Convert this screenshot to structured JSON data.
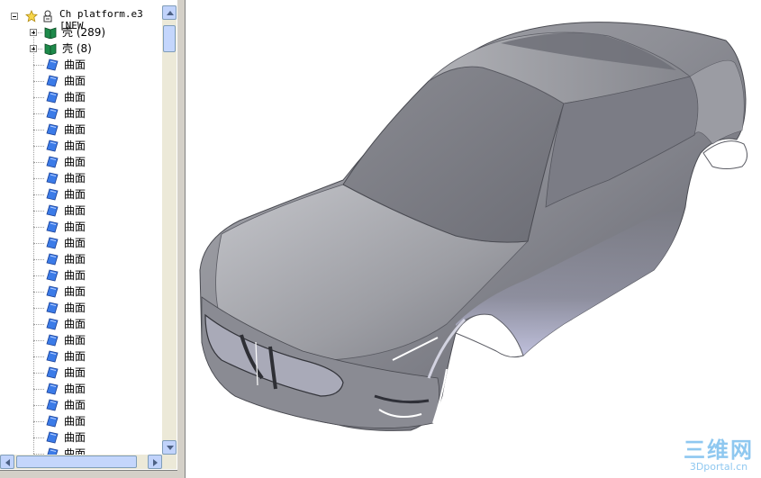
{
  "tree": {
    "root": {
      "label": "Ch platform.e3 [NEW"
    },
    "shells": [
      {
        "label": "壳 (289)"
      },
      {
        "label": "壳 (8)"
      }
    ],
    "surface_label": "曲面",
    "surface_count": 25
  },
  "colors": {
    "folder_green": "#1d8a4a",
    "surface_blue": "#3b7be8",
    "scrollbar_blue": "#c1d3fb"
  },
  "icons": {
    "root": "star-icon",
    "root_model": "part-tree-icon",
    "shell": "book-icon",
    "surface": "surface-icon"
  },
  "watermark": {
    "logo": "三维网",
    "url": "3Dportal.cn"
  }
}
